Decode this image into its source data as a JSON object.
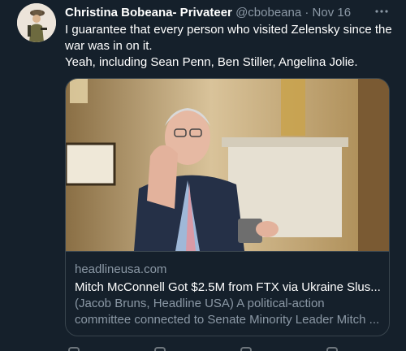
{
  "tweet": {
    "display_name": "Christina Bobeana- Privateer",
    "handle": "@cbobeana",
    "separator": "·",
    "date": "Nov 16",
    "more_icon": "more-horizontal-icon",
    "text_line1": "I guarantee that every person who visited Zelensky since the war was in on it.",
    "text_line2": "Yeah, including Sean Penn, Ben Stiller, Angelina Jolie."
  },
  "card": {
    "domain": "headlineusa.com",
    "title": "Mitch McConnell Got $2.5M from FTX via Ukraine Slus...",
    "desc_line1": "(Jacob Bruns, Headline USA) A political-action",
    "desc_line2": "committee connected to Senate Minority Leader Mitch ..."
  },
  "colors": {
    "background": "#15202b",
    "border": "#38444d",
    "secondary_text": "#8b98a5",
    "primary_text": "#ffffff"
  }
}
